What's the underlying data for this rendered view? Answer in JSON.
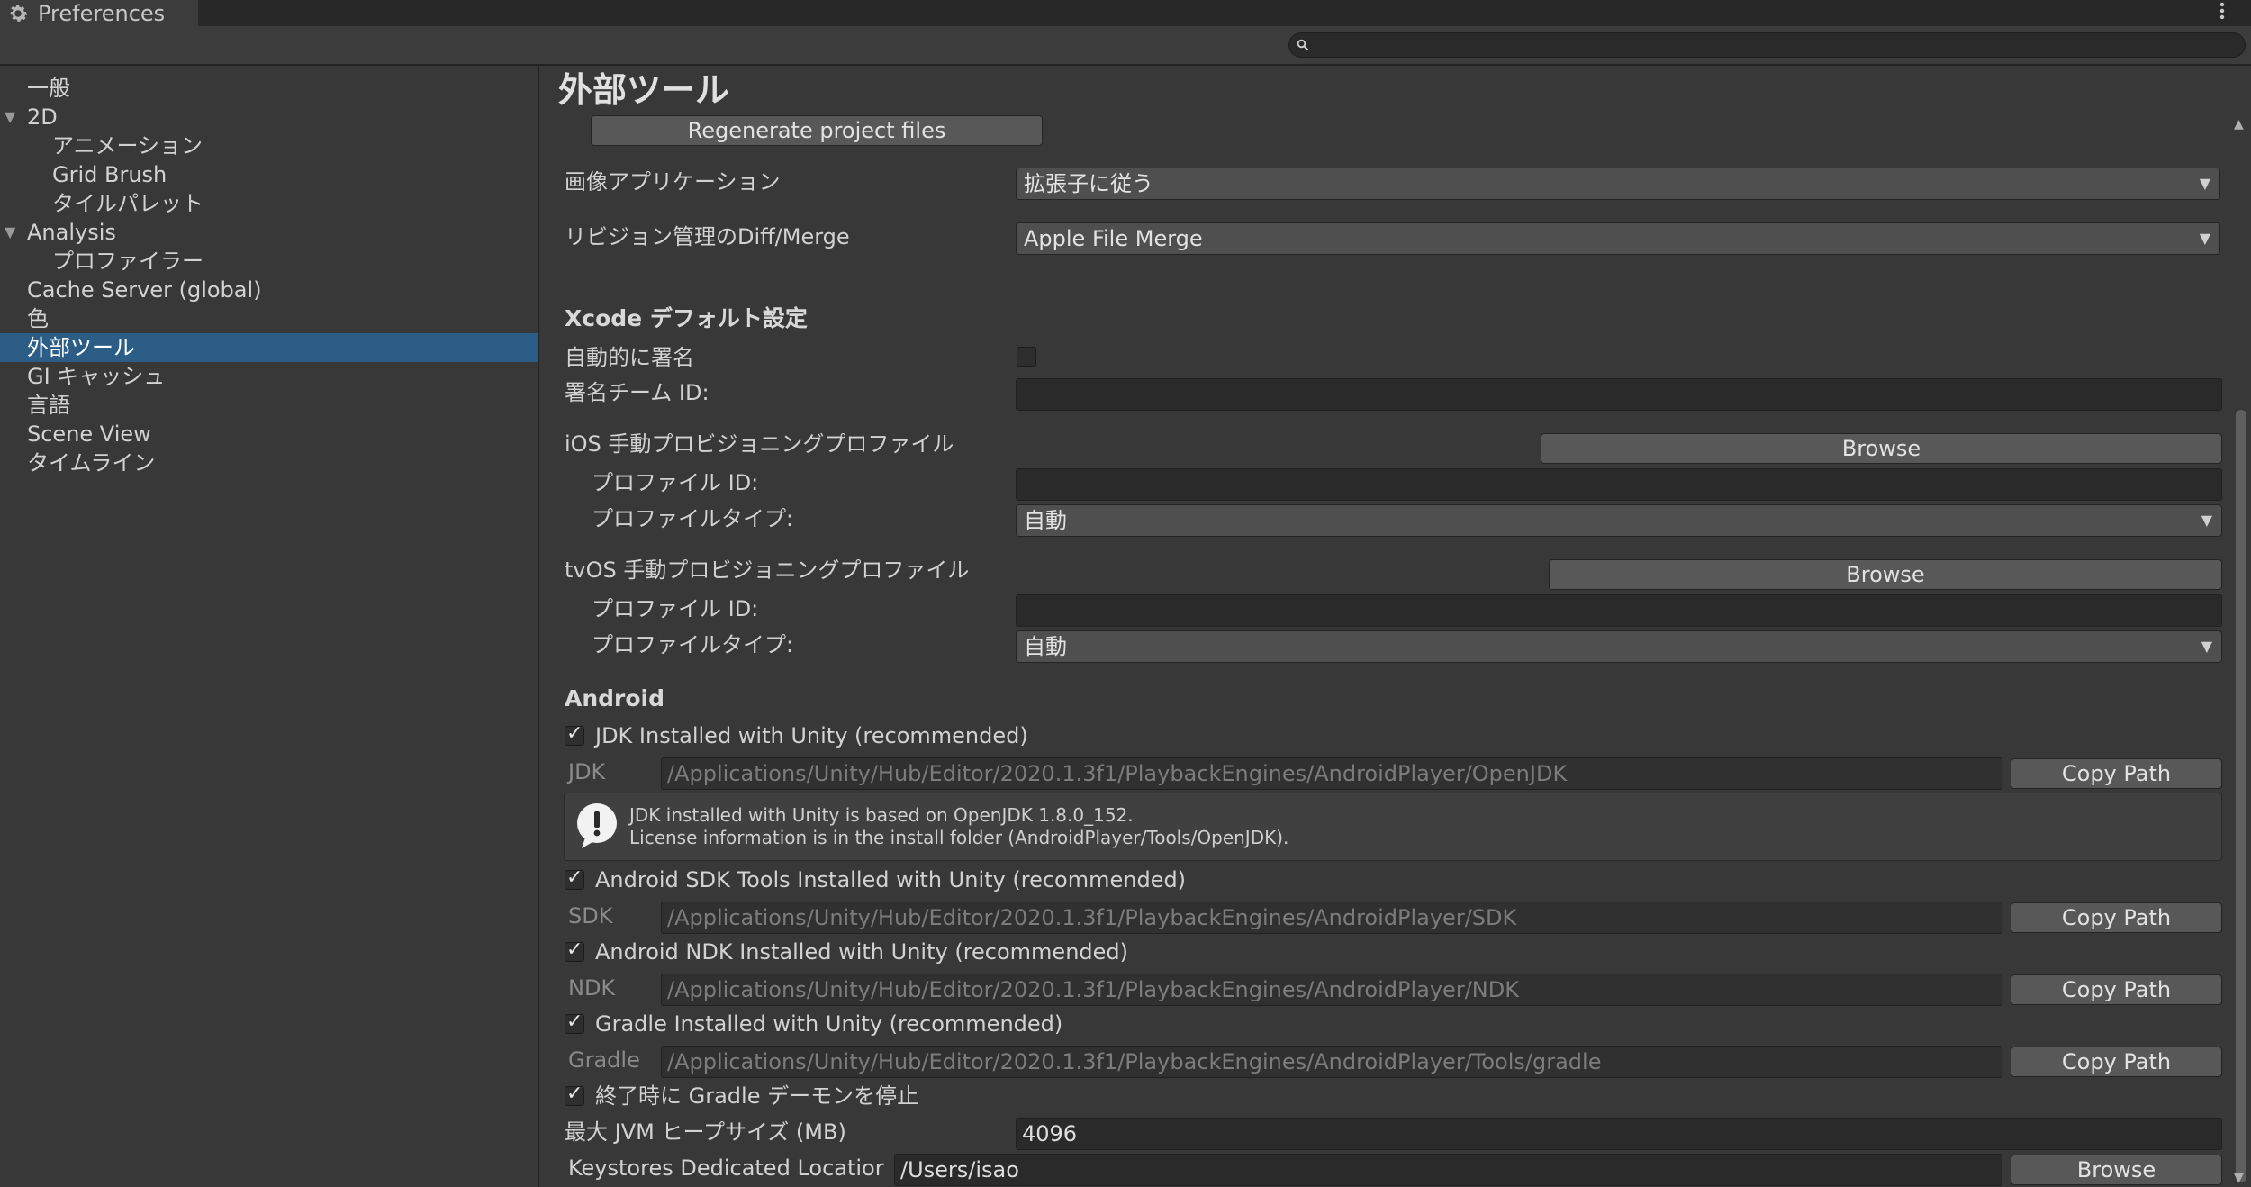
{
  "window": {
    "title": "Preferences",
    "icon": "gear-icon",
    "menu_icon": "kebab-menu-icon"
  },
  "search": {
    "placeholder": "",
    "icon": "search-icon"
  },
  "sidebar": {
    "items": [
      {
        "label": "一般"
      },
      {
        "label": "2D",
        "expanded": true
      },
      {
        "label": "アニメーション"
      },
      {
        "label": "Grid Brush"
      },
      {
        "label": "タイルパレット"
      },
      {
        "label": "Analysis",
        "expanded": true
      },
      {
        "label": "プロファイラー"
      },
      {
        "label": "Cache Server (global)"
      },
      {
        "label": "色"
      },
      {
        "label": "外部ツール",
        "selected": true
      },
      {
        "label": "GI キャッシュ"
      },
      {
        "label": "言語"
      },
      {
        "label": "Scene View"
      },
      {
        "label": "タイムライン"
      }
    ],
    "expand_glyph": "▼",
    "selected_color": "#2c5d87"
  },
  "main": {
    "title": "外部ツール",
    "regenerate_label": "Regenerate project files",
    "image_app": {
      "label": "画像アプリケーション",
      "value": "拡張子に従う"
    },
    "diff_merge": {
      "label": "リビジョン管理のDiff/Merge",
      "value": "Apple File Merge"
    },
    "dropdown_arrow": "▼",
    "xcode": {
      "heading": "Xcode デフォルト設定",
      "auto_sign_label": "自動的に署名",
      "auto_sign_checked": false,
      "team_id_label": "署名チーム ID:",
      "team_id_value": "",
      "ios_heading": "iOS 手動プロビジョニングプロファイル",
      "ios_browse": "Browse",
      "ios_profile_id_label": "プロファイル ID:",
      "ios_profile_id_value": "",
      "ios_profile_type_label": "プロファイルタイプ:",
      "ios_profile_type_value": "自動",
      "tvos_heading": "tvOS 手動プロビジョニングプロファイル",
      "tvos_browse": "Browse",
      "tvos_profile_id_label": "プロファイル ID:",
      "tvos_profile_id_value": "",
      "tvos_profile_type_label": "プロファイルタイプ:",
      "tvos_profile_type_value": "自動"
    },
    "android": {
      "heading": "Android",
      "check_glyph": "✓",
      "jdk_check": "JDK Installed with Unity (recommended)",
      "jdk_label": "JDK",
      "jdk_path": "/Applications/Unity/Hub/Editor/2020.1.3f1/PlaybackEngines/AndroidPlayer/OpenJDK",
      "jdk_copy": "Copy Path",
      "help_line1": "JDK installed with Unity is based on OpenJDK 1.8.0_152.",
      "help_line2": "License information is in the install folder (AndroidPlayer/Tools/OpenJDK).",
      "help_icon": "info-exclamation-icon",
      "sdk_check": "Android SDK Tools Installed with Unity (recommended)",
      "sdk_label": "SDK",
      "sdk_path": "/Applications/Unity/Hub/Editor/2020.1.3f1/PlaybackEngines/AndroidPlayer/SDK",
      "sdk_copy": "Copy Path",
      "ndk_check": "Android NDK Installed with Unity (recommended)",
      "ndk_label": "NDK",
      "ndk_path": "/Applications/Unity/Hub/Editor/2020.1.3f1/PlaybackEngines/AndroidPlayer/NDK",
      "ndk_copy": "Copy Path",
      "gradle_check": "Gradle Installed with Unity (recommended)",
      "gradle_label": "Gradle",
      "gradle_path": "/Applications/Unity/Hub/Editor/2020.1.3f1/PlaybackEngines/AndroidPlayer/Tools/gradle",
      "gradle_copy": "Copy Path",
      "stop_daemon_check": "終了時に Gradle デーモンを停止",
      "jvm_label": "最大 JVM ヒープサイズ (MB)",
      "jvm_value": "4096",
      "keystore_label": "Keystores Dedicated Locatior",
      "keystore_value": "/Users/isao",
      "keystore_browse": "Browse"
    }
  },
  "scrollbar": {
    "up": "▲",
    "down": "▼"
  }
}
